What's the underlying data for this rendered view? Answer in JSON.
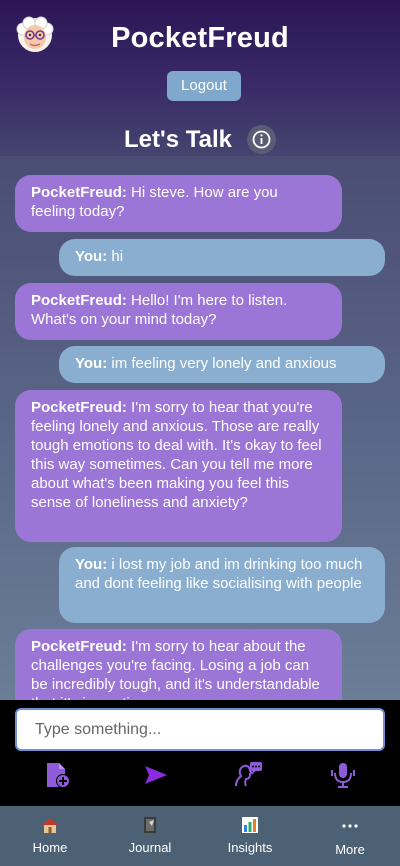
{
  "header": {
    "title": "PocketFreud",
    "logout_label": "Logout",
    "section_title": "Let's Talk"
  },
  "messages": [
    {
      "sender": "PocketFreud",
      "text": "Hi steve. How are you feeling today?"
    },
    {
      "sender": "You",
      "text": "hi"
    },
    {
      "sender": "PocketFreud",
      "text": "Hello! I'm here to listen. What's on your mind today?"
    },
    {
      "sender": "You",
      "text": "im feeling very lonely and anxious"
    },
    {
      "sender": "PocketFreud",
      "text": "I'm sorry to hear that you're feeling lonely and anxious. Those are really tough emotions to deal with. It's okay to feel this way sometimes. Can you tell me more about what's been making you feel this sense of loneliness and anxiety?"
    },
    {
      "sender": "You",
      "text": "i lost my job and im drinking too much and dont feeling like socialising with people"
    },
    {
      "sender": "PocketFreud",
      "text": "I'm sorry to hear about the challenges you're facing. Losing a job can be incredibly tough, and it's understandable that it's impacting"
    }
  ],
  "composer": {
    "placeholder": "Type something...",
    "tools": [
      "add-file-icon",
      "send-icon",
      "speak-icon",
      "microphone-icon"
    ]
  },
  "tabs": [
    {
      "label": "Home",
      "icon": "house-icon"
    },
    {
      "label": "Journal",
      "icon": "journal-icon"
    },
    {
      "label": "Insights",
      "icon": "chart-icon"
    },
    {
      "label": "More",
      "icon": "more-icon"
    }
  ],
  "colors": {
    "bot_bubble": "#9b76d6",
    "user_bubble": "#8aaed0",
    "logout": "#7fa8cc",
    "accent": "#8a2be2",
    "tabbar": "#4d6174"
  }
}
